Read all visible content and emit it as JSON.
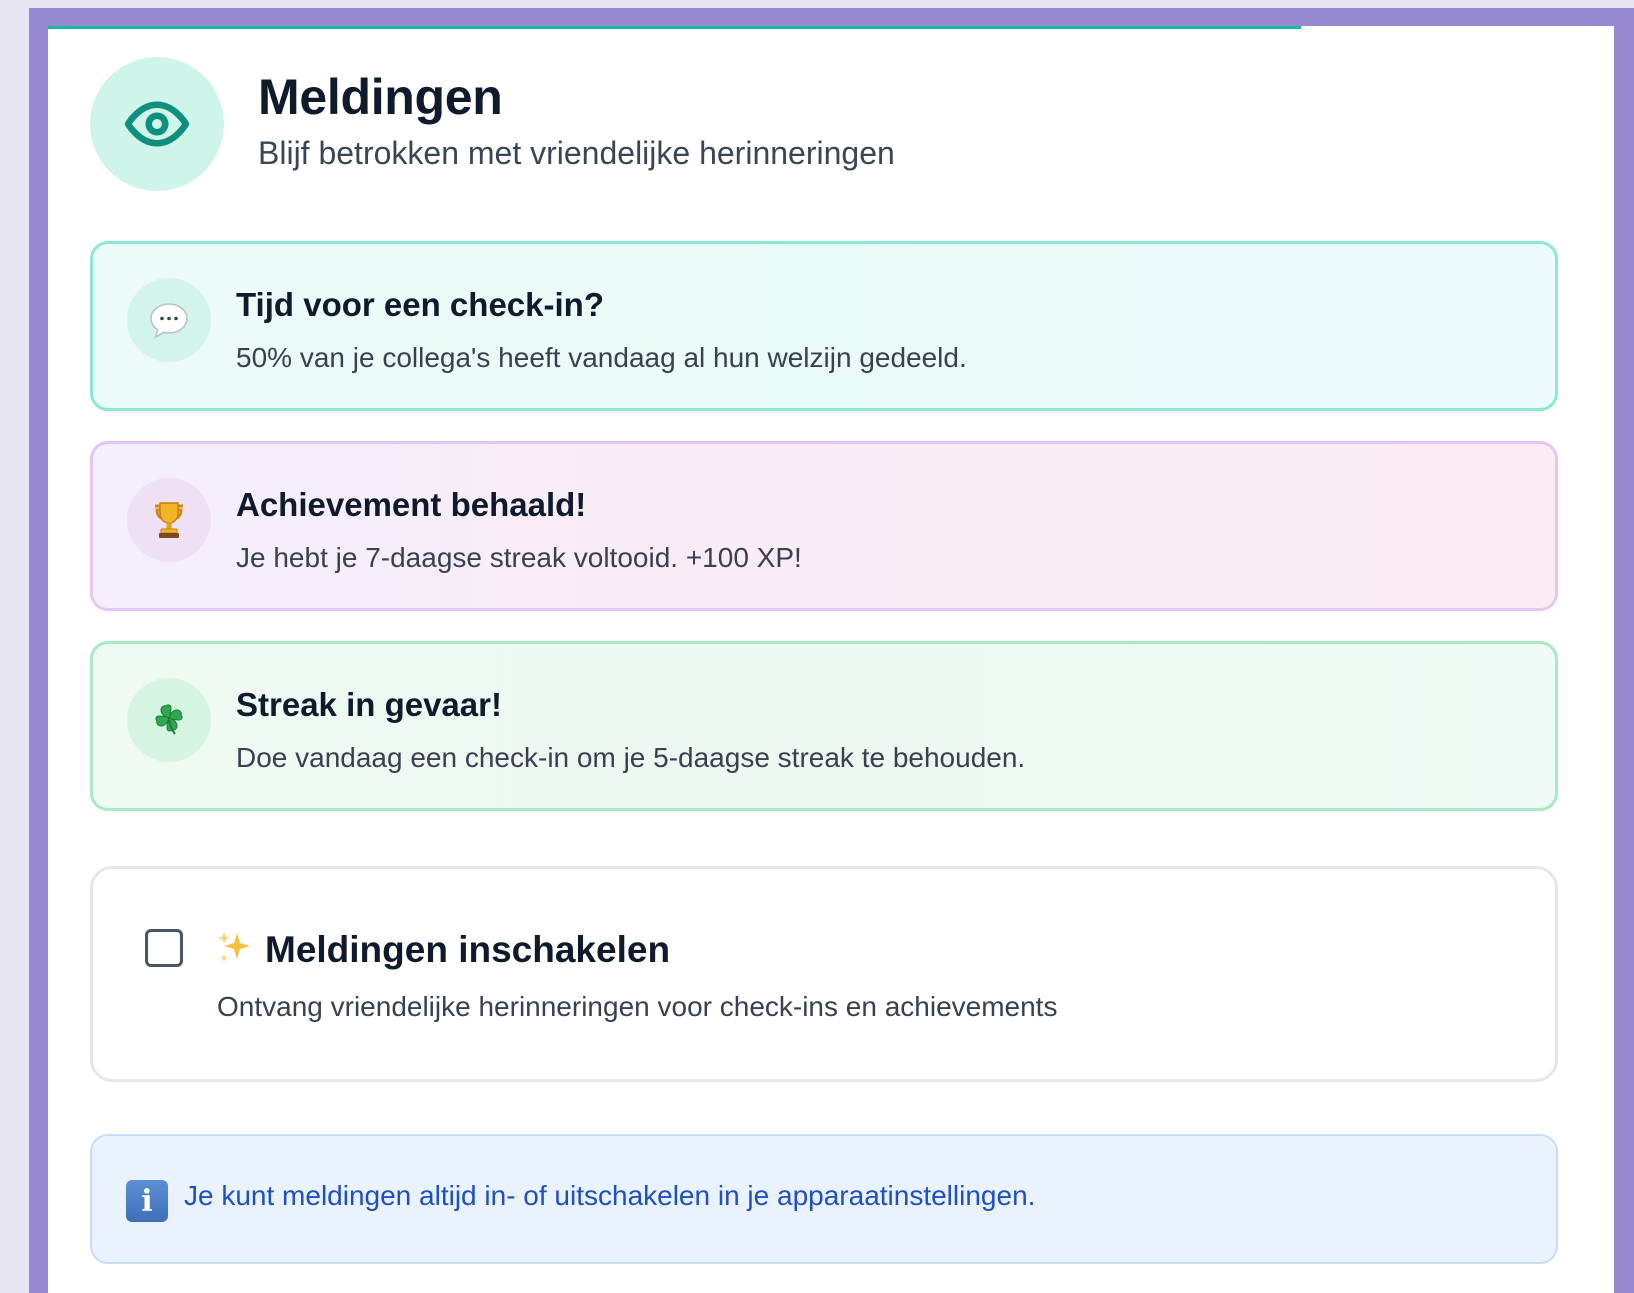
{
  "header": {
    "title": "Meldingen",
    "subtitle": "Blijf betrokken met vriendelijke herinneringen",
    "icon": "eye-icon"
  },
  "notifications": [
    {
      "icon": "speech-bubble-icon",
      "title": "Tijd voor een check-in?",
      "body": "50% van je collega's heeft vandaag al hun welzijn gedeeld.",
      "accent": "#8be8d4"
    },
    {
      "icon": "trophy-icon",
      "title": "Achievement behaald!",
      "body": "Je hebt je 7-daagse streak voltooid. +100 XP!",
      "accent": "#e4c6f4"
    },
    {
      "icon": "four-leaf-clover-icon",
      "title": "Streak in gevaar!",
      "body": "Doe vandaag een check-in om je 5-daagse streak te behouden.",
      "accent": "#a8eac6"
    }
  ],
  "toggle": {
    "checked": false,
    "icon": "sparkles-icon",
    "label": "Meldingen inschakelen",
    "description": "Ontvang vriendelijke herinneringen voor check-ins en achievements"
  },
  "info": {
    "icon": "info-icon",
    "text": "Je kunt meldingen altijd in- of uitschakelen in je apparaatinstellingen."
  },
  "colors": {
    "brand_teal": "#14b8a6",
    "frame_purple": "#9789d1",
    "info_blue": "#1f4fc4"
  },
  "progress": {
    "fraction": 0.8
  }
}
